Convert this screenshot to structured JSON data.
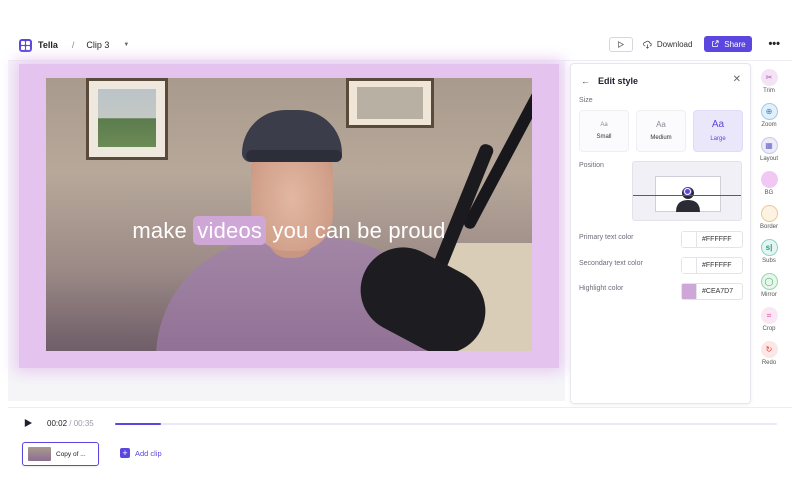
{
  "header": {
    "app_name": "Tella",
    "separator": "/",
    "clip_name": "Clip 3",
    "download_label": "Download",
    "share_label": "Share",
    "more_label": "•••",
    "brand_color": "#5B47E0"
  },
  "video": {
    "subtitle_before": "make ",
    "subtitle_highlight": "videos",
    "subtitle_after": " you can be proud"
  },
  "edit_panel": {
    "title": "Edit style",
    "size_label": "Size",
    "sizes": [
      {
        "glyph": "Aa",
        "name": "Small",
        "active": false
      },
      {
        "glyph": "Aa",
        "name": "Medium",
        "active": false
      },
      {
        "glyph": "Aa",
        "name": "Large",
        "active": true
      }
    ],
    "position_label": "Position",
    "primary_label": "Primary text color",
    "primary_value": "#FFFFFF",
    "secondary_label": "Secondary text color",
    "secondary_value": "#FFFFFF",
    "highlight_label": "Highlight color",
    "highlight_value": "#CEA7D7"
  },
  "tools": [
    {
      "label": "Trim",
      "icon": "trim-icon"
    },
    {
      "label": "Zoom",
      "icon": "zoom-icon"
    },
    {
      "label": "Layout",
      "icon": "layout-icon"
    },
    {
      "label": "BG",
      "icon": "background-icon"
    },
    {
      "label": "Border",
      "icon": "border-icon"
    },
    {
      "label": "Subs",
      "icon": "subtitles-icon"
    },
    {
      "label": "Mirror",
      "icon": "mirror-icon"
    },
    {
      "label": "Crop",
      "icon": "crop-icon"
    },
    {
      "label": "Redo",
      "icon": "redo-icon"
    }
  ],
  "player": {
    "current_time": "00:02",
    "total_time": " / 00:35",
    "progress": 0.07
  },
  "clips": {
    "clip_label": "Copy of ...",
    "add_clip_label": "Add clip"
  }
}
